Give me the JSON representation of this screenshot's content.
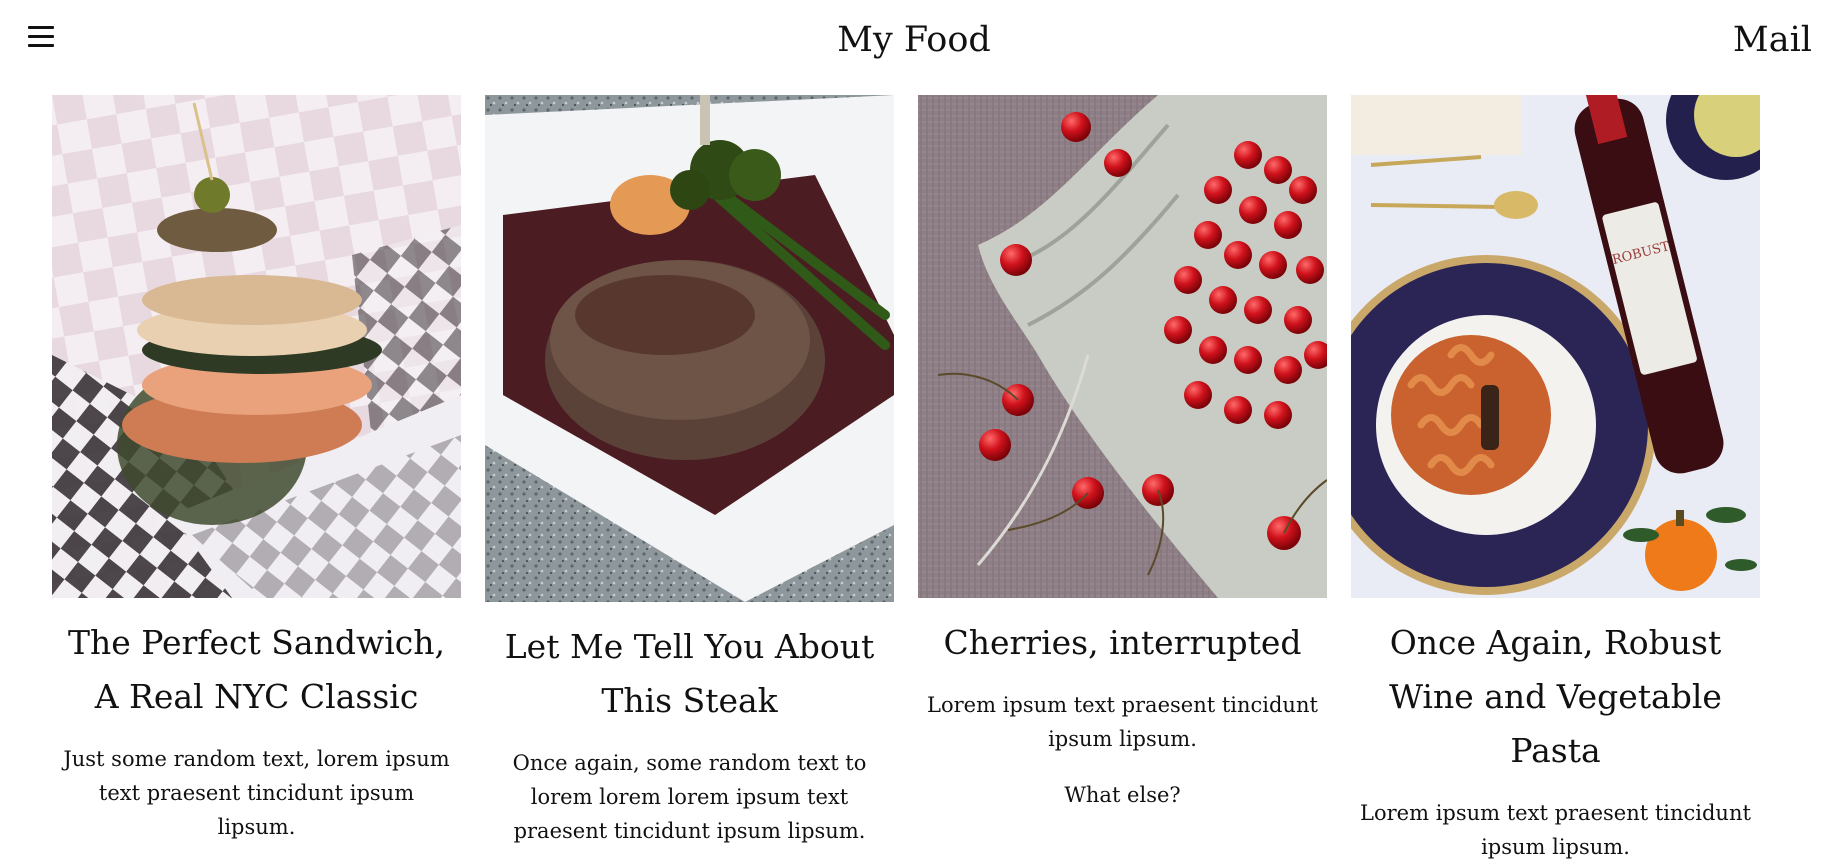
{
  "header": {
    "title": "My Food",
    "mail_label": "Mail",
    "menu_icon": "hamburger-menu-icon"
  },
  "cards": [
    {
      "title": "The Perfect Sandwich, A Real NYC Classic",
      "text": "Just some random text, lorem ipsum text praesent tincidunt ipsum lipsum.",
      "image": "sandwich-photo"
    },
    {
      "title": "Let Me Tell You About This Steak",
      "text": "Once again, some random text to lorem lorem lorem ipsum text praesent tincidunt ipsum lipsum.",
      "image": "steak-photo"
    },
    {
      "title": "Cherries, interrupted",
      "text": "Lorem ipsum text praesent tincidunt ipsum lipsum.",
      "text2": "What else?",
      "image": "cherries-photo"
    },
    {
      "title": "Once Again, Robust Wine and Vegetable Pasta",
      "text": "Lorem ipsum text praesent tincidunt ipsum lipsum.",
      "image": "wine-pasta-photo",
      "bottle_label": "ROBUST"
    }
  ]
}
